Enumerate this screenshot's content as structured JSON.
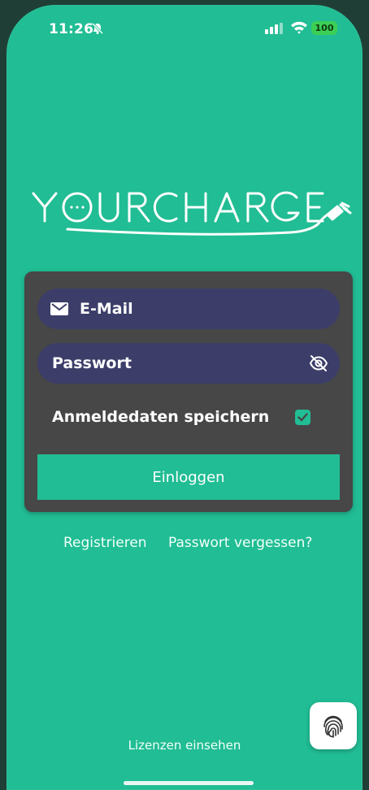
{
  "status_bar": {
    "time": "11:26",
    "battery": "100",
    "icons": [
      "bell-slash-icon",
      "signal-icon",
      "wifi-icon",
      "battery-icon"
    ]
  },
  "logo": {
    "text": "YOURCHARGE",
    "icon": "charging-plug-icon"
  },
  "login_form": {
    "email_placeholder": "E-Mail",
    "password_placeholder": "Passwort",
    "remember_label": "Anmeldedaten speichern",
    "remember_checked": true,
    "login_button": "Einloggen"
  },
  "links": {
    "register": "Registrieren",
    "forgot_password": "Passwort vergessen?"
  },
  "footer": {
    "licenses": "Lizenzen einsehen",
    "fingerprint_icon": "fingerprint-icon"
  },
  "colors": {
    "background": "#21bd94",
    "card": "#474747",
    "input": "#3c3e69"
  }
}
